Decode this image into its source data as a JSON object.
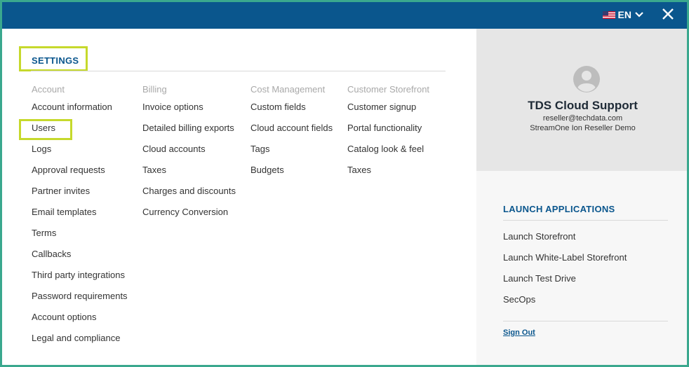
{
  "header": {
    "language": "EN",
    "flag_icon": "us-flag-icon",
    "dropdown_icon": "chevron-down-icon",
    "close_icon": "close-icon",
    "bar_color": "#0a568d"
  },
  "settings": {
    "title": "SETTINGS",
    "highlight_color": "#c6d92c",
    "columns": [
      {
        "heading": "Account",
        "items": [
          "Account information",
          "Users",
          "Logs",
          "Approval requests",
          "Partner invites",
          "Email templates",
          "Terms",
          "Callbacks",
          "Third party integrations",
          "Password requirements",
          "Account options",
          "Legal and compliance"
        ]
      },
      {
        "heading": "Billing",
        "items": [
          "Invoice options",
          "Detailed billing exports",
          "Cloud accounts",
          "Taxes",
          "Charges and discounts",
          "Currency Conversion"
        ]
      },
      {
        "heading": "Cost Management",
        "items": [
          "Custom fields",
          "Cloud account fields",
          "Tags",
          "Budgets"
        ]
      },
      {
        "heading": "Customer Storefront",
        "items": [
          "Customer signup",
          "Portal functionality",
          "Catalog look & feel",
          "Taxes"
        ]
      }
    ]
  },
  "profile": {
    "avatar_icon": "user-avatar-icon",
    "name": "TDS Cloud Support",
    "email": "reseller@techdata.com",
    "organization": "StreamOne Ion Reseller Demo"
  },
  "launch": {
    "title": "LAUNCH APPLICATIONS",
    "items": [
      "Launch Storefront",
      "Launch White-Label Storefront",
      "Launch Test Drive",
      "SecOps"
    ],
    "sign_out": "Sign Out"
  }
}
